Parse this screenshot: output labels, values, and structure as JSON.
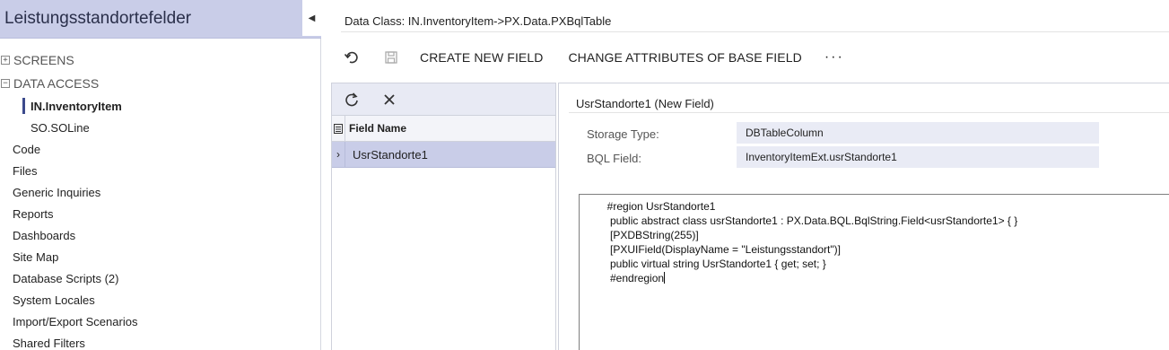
{
  "sidebar": {
    "title": "Leistungsstandortefelder",
    "collapse_glyph": "◀",
    "groups": [
      {
        "label": "SCREENS",
        "expander": "+"
      },
      {
        "label": "DATA ACCESS",
        "expander": "−"
      }
    ],
    "data_access_items": [
      {
        "label": "IN.InventoryItem"
      },
      {
        "label": "SO.SOLine"
      }
    ],
    "items": [
      {
        "label": "Code"
      },
      {
        "label": "Files"
      },
      {
        "label": "Generic Inquiries"
      },
      {
        "label": "Reports"
      },
      {
        "label": "Dashboards"
      },
      {
        "label": "Site Map"
      },
      {
        "label": "Database Scripts (2)"
      },
      {
        "label": "System Locales"
      },
      {
        "label": "Import/Export Scenarios"
      },
      {
        "label": "Shared Filters"
      }
    ]
  },
  "main": {
    "data_class": "Data Class: IN.InventoryItem->PX.Data.PXBqlTable",
    "toolbar": {
      "create_new_field": "CREATE NEW FIELD",
      "change_attributes": "CHANGE ATTRIBUTES OF BASE FIELD",
      "more": "···"
    },
    "grid": {
      "column_header": "Field Name",
      "rows": [
        {
          "selector": "›",
          "field_name": "UsrStandorte1"
        }
      ]
    },
    "detail": {
      "title": "UsrStandorte1 (New Field)",
      "storage_type_label": "Storage Type:",
      "storage_type_value": "DBTableColumn",
      "bql_field_label": "BQL Field:",
      "bql_field_value": "InventoryItemExt.usrStandorte1",
      "code_lines": [
        "        #region UsrStandorte1",
        "         public abstract class usrStandorte1 : PX.Data.BQL.BqlString.Field<usrStandorte1> { }",
        "         [PXDBString(255)]",
        "         [PXUIField(DisplayName = \"Leistungsstandort\")]",
        "         public virtual string UsrStandorte1 { get; set; }",
        "         #endregion"
      ]
    }
  },
  "colors": {
    "header_bg": "#c9cde8",
    "selected_row_bg": "#c9cde8",
    "active_indicator": "#3c4a8c",
    "input_bg": "#e9ebf5"
  },
  "icons": {
    "undo": "undo-icon",
    "save": "save-icon",
    "refresh": "refresh-icon",
    "delete": "close-icon",
    "select_all": "grid-select-icon"
  }
}
